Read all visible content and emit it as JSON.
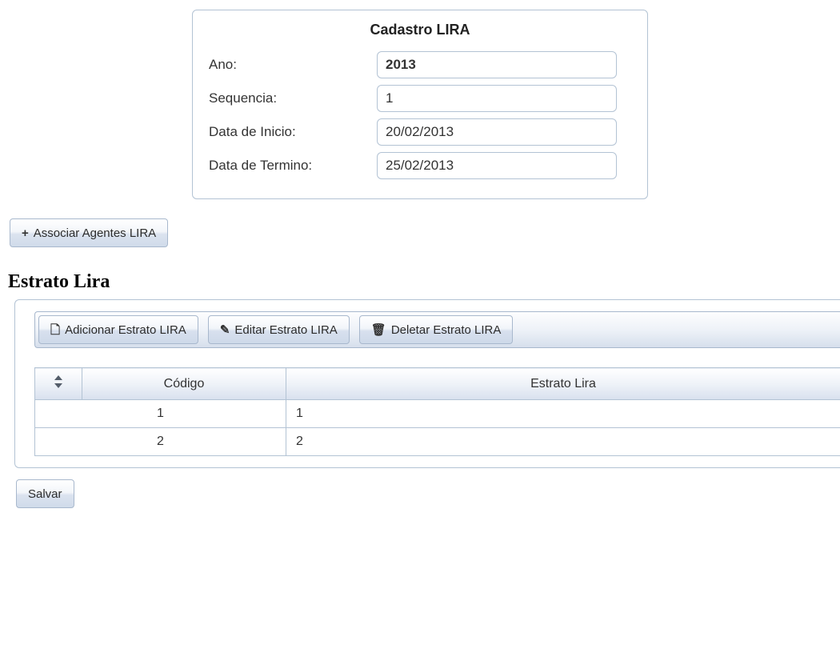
{
  "form": {
    "title": "Cadastro LIRA",
    "fields": {
      "ano": {
        "label": "Ano:",
        "value": "2013"
      },
      "sequencia": {
        "label": "Sequencia:",
        "value": "1"
      },
      "data_inicio": {
        "label": "Data de Inicio:",
        "value": "20/02/2013"
      },
      "data_termino": {
        "label": "Data de Termino:",
        "value": "25/02/2013"
      }
    }
  },
  "buttons": {
    "associate": "Associar Agentes LIRA",
    "add_estrato": "Adicionar Estrato LIRA",
    "edit_estrato": "Editar Estrato LIRA",
    "del_estrato": "Deletar Estrato LIRA",
    "save": "Salvar"
  },
  "section": {
    "heading": "Estrato Lira"
  },
  "table": {
    "columns": {
      "codigo": "Código",
      "estrato": "Estrato Lira"
    },
    "rows": [
      {
        "codigo": "1",
        "estrato": "1"
      },
      {
        "codigo": "2",
        "estrato": "2"
      }
    ]
  }
}
